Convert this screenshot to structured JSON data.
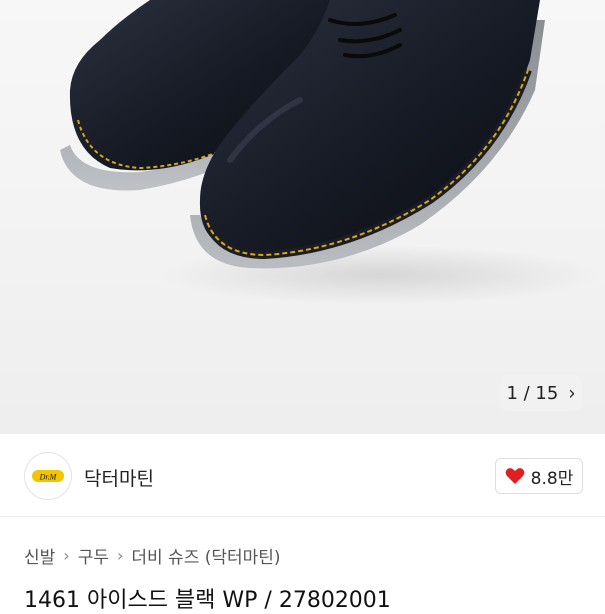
{
  "gallery": {
    "image_counter": "1 / 15",
    "next_icon": "chevron-right-icon"
  },
  "brand": {
    "name": "닥터마틴",
    "like_count": "8.8만",
    "like_icon": "heart-icon",
    "like_color": "#e02020"
  },
  "breadcrumb": {
    "items": [
      "신발",
      "구두",
      "더비 슈즈 (닥터마틴)"
    ],
    "separator_icon": "chevron-right-icon"
  },
  "product": {
    "title": "1461 아이스드 블랙 WP / 27802001"
  }
}
